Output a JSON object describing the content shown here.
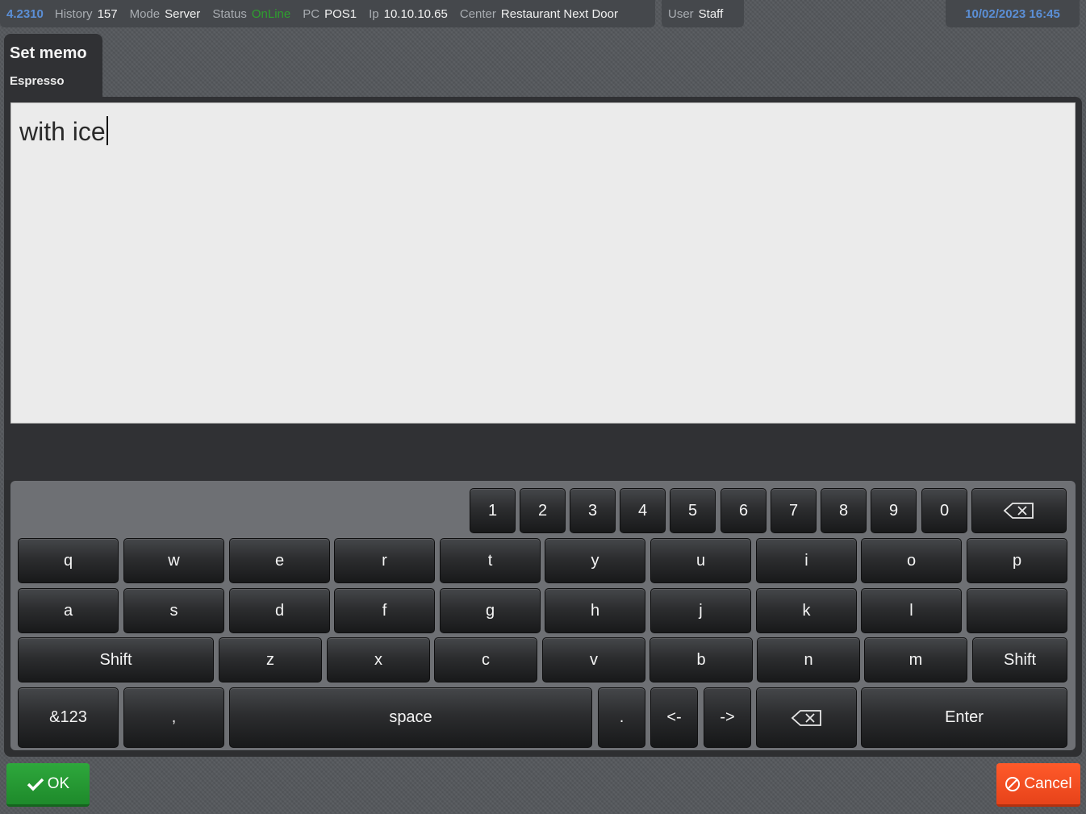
{
  "status_bar": {
    "version": "4.2310",
    "history_label": "History",
    "history_value": "157",
    "mode_label": "Mode",
    "mode_value": "Server",
    "status_label": "Status",
    "status_value": "OnLine",
    "pc_label": "PC",
    "pc_value": "POS1",
    "ip_label": "Ip",
    "ip_value": "10.10.10.65",
    "center_label": "Center",
    "center_value": "Restaurant Next Door",
    "user_label": "User",
    "user_value": "Staff",
    "datetime": "10/02/2023 16:45"
  },
  "dialog": {
    "title": "Set memo",
    "subtitle": "Espresso",
    "memo_text": "with ice"
  },
  "keyboard": {
    "row_numbers": [
      "1",
      "2",
      "3",
      "4",
      "5",
      "6",
      "7",
      "8",
      "9",
      "0"
    ],
    "row_top": [
      "q",
      "w",
      "e",
      "r",
      "t",
      "y",
      "u",
      "i",
      "o",
      "p"
    ],
    "row_home": [
      "a",
      "s",
      "d",
      "f",
      "g",
      "h",
      "j",
      "k",
      "l",
      ""
    ],
    "row_bottom": [
      "z",
      "x",
      "c",
      "v",
      "b",
      "n",
      "m"
    ],
    "shift_left": "Shift",
    "shift_right": "Shift",
    "symbols": "&123",
    "comma": ",",
    "space": "space",
    "period": ".",
    "left_arrow": "<-",
    "right_arrow": "->",
    "enter": "Enter",
    "backspace_icon": "backspace-icon"
  },
  "buttons": {
    "ok": "OK",
    "cancel": "Cancel",
    "ok_icon": "checkmark-icon",
    "cancel_icon": "prohibited-icon"
  },
  "colors": {
    "online": "#2ea02e",
    "accent_blue": "#5b8fd6",
    "ok_green": "#27a036",
    "cancel_orange": "#f55024"
  }
}
